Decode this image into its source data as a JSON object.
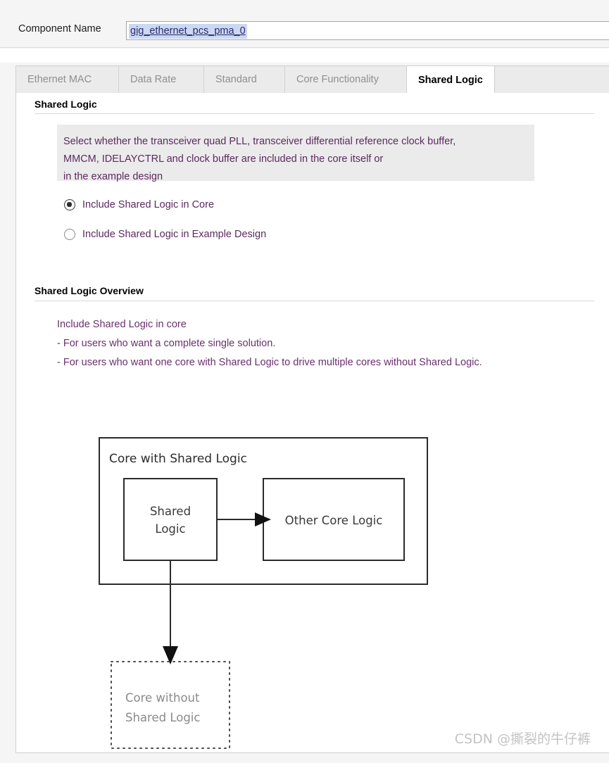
{
  "header": {
    "component_name_label": "Component Name",
    "component_name_value": "gig_ethernet_pcs_pma_0"
  },
  "tabs": [
    {
      "label": "Ethernet MAC",
      "active": false
    },
    {
      "label": "Data Rate",
      "active": false
    },
    {
      "label": "Standard",
      "active": false
    },
    {
      "label": "Core Functionality",
      "active": false
    },
    {
      "label": "Shared Logic",
      "active": true
    }
  ],
  "shared_logic": {
    "section_title": "Shared Logic",
    "description_lines": [
      "Select whether the transceiver quad PLL, transceiver differential reference clock buffer,",
      "MMCM, IDELAYCTRL and clock buffer are included in the core itself or",
      "in the example design"
    ],
    "options": [
      {
        "label": "Include Shared Logic in Core",
        "selected": true
      },
      {
        "label": "Include Shared Logic in Example Design",
        "selected": false
      }
    ]
  },
  "overview": {
    "section_title": "Shared Logic Overview",
    "lines": [
      "Include Shared Logic in core",
      "- For users who want a complete single solution.",
      "- For users who want one core with Shared Logic to drive multiple cores without Shared Logic."
    ]
  },
  "diagram": {
    "outer_box_label": "Core with Shared Logic",
    "shared_logic_box": {
      "line1": "Shared",
      "line2": "Logic"
    },
    "other_core_box": "Other Core Logic",
    "without_box": {
      "line1": "Core without",
      "line2": "Shared Logic"
    }
  },
  "watermark": "CSDN @撕裂的牛仔裤",
  "colors": {
    "accent_text": "#5b2a5e",
    "panel_bg": "#ffffff",
    "chrome_bg": "#f5f5f5",
    "info_box_bg": "#ebebeb",
    "field_highlight": "#cbd8f2",
    "watermark": "#c3c3c3"
  }
}
